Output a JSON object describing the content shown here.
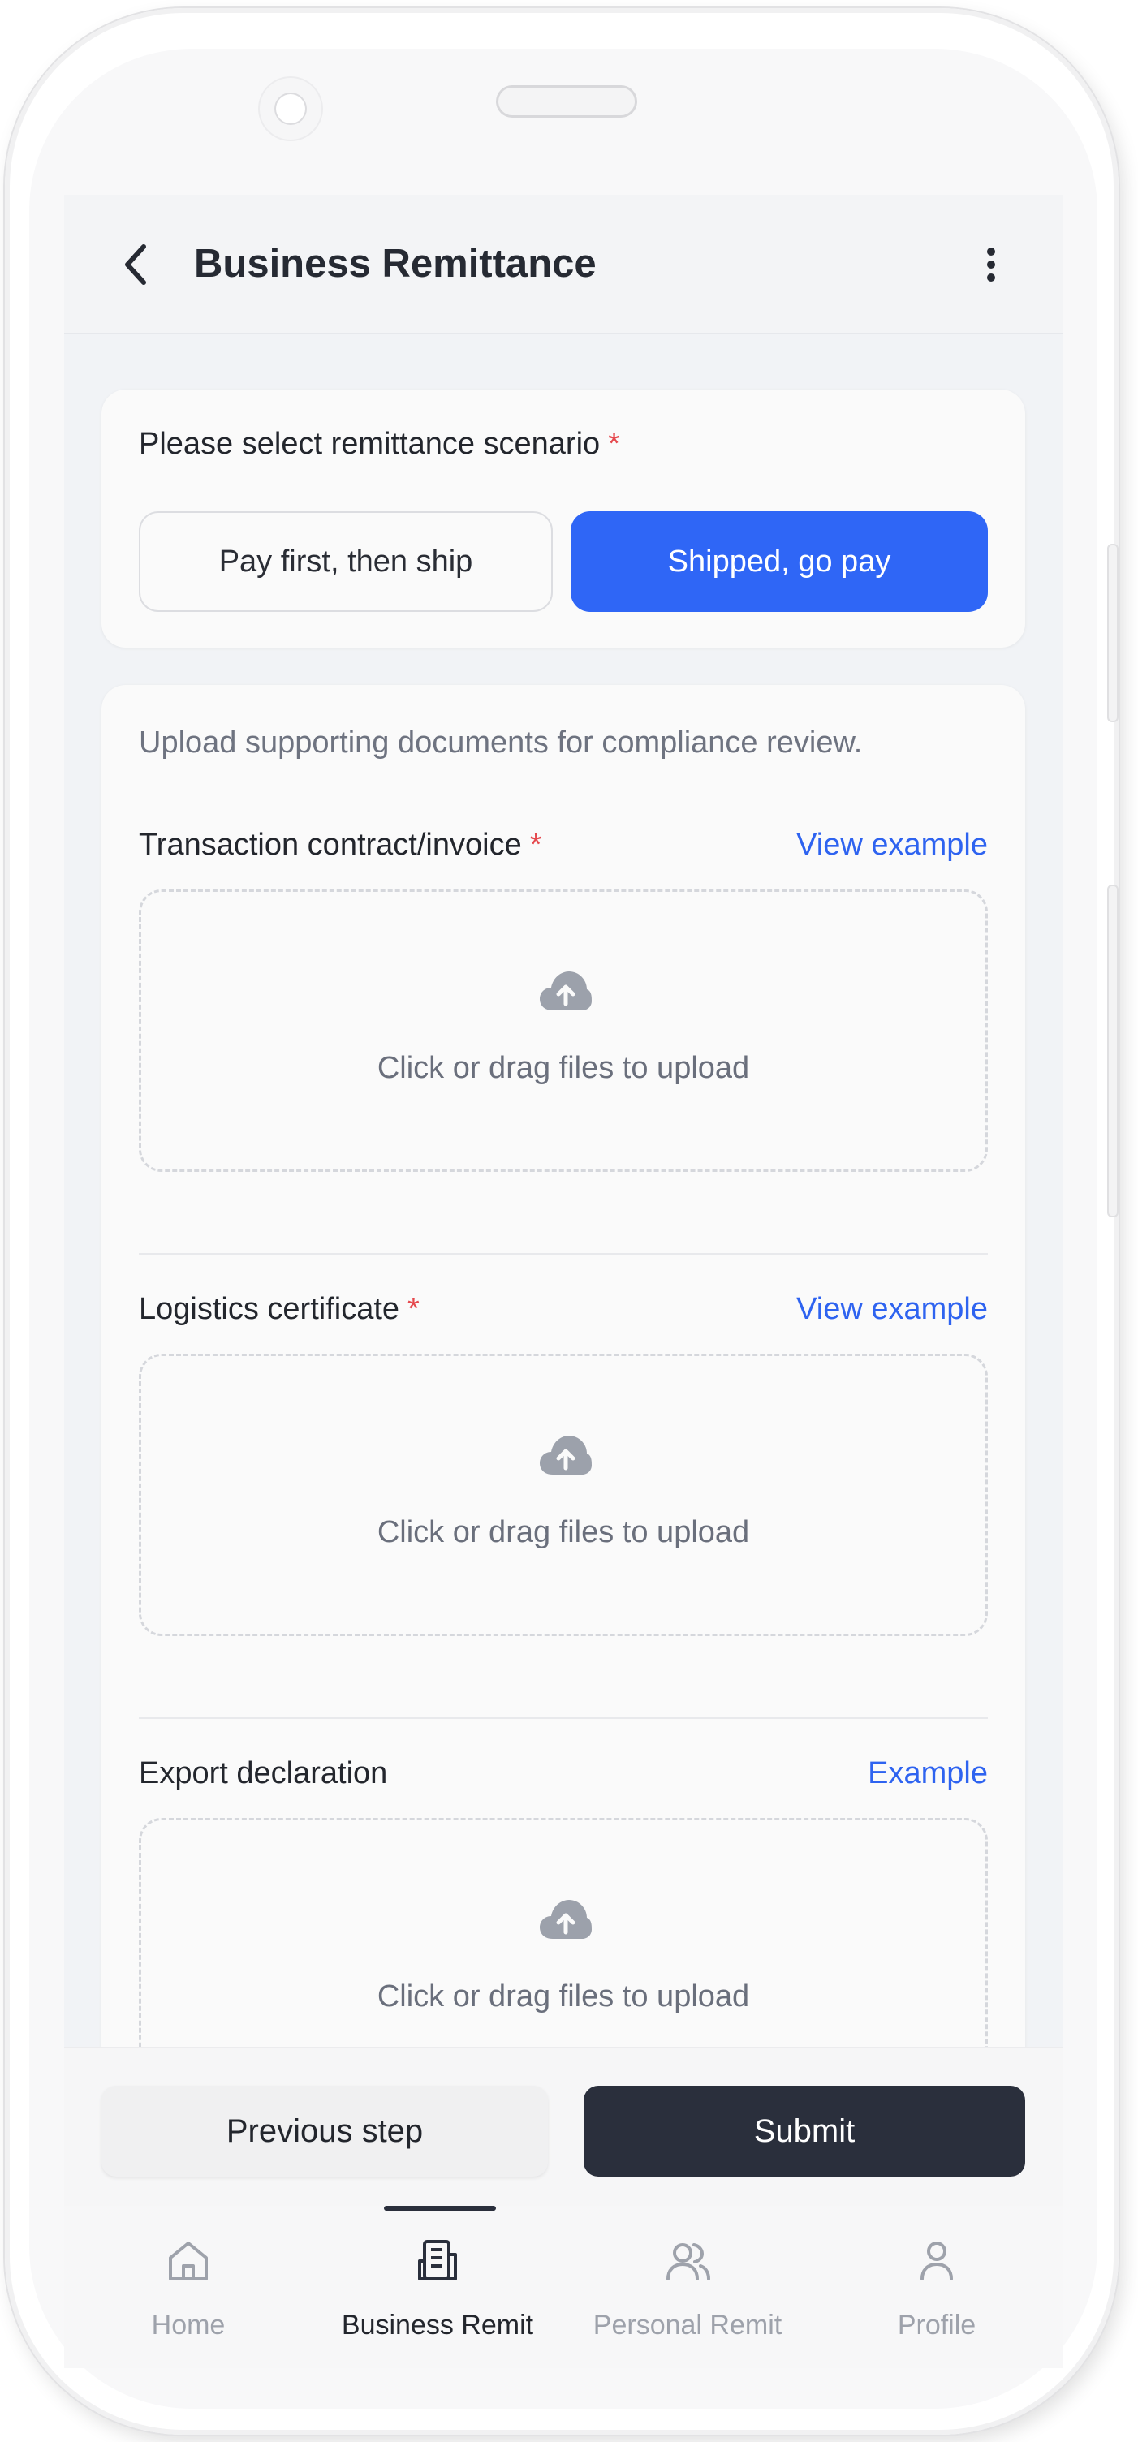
{
  "header": {
    "title": "Business Remittance",
    "back_icon": "chevron-left-icon",
    "more_icon": "more-vertical-icon"
  },
  "scenario": {
    "label": "Please select remittance scenario",
    "required_mark": "*",
    "options": [
      "Pay first, then ship",
      "Shipped, go pay"
    ],
    "selected": "Shipped, go pay"
  },
  "documents": {
    "description": "Upload supporting documents for compliance review.",
    "items": [
      {
        "label": "Transaction contract/invoice",
        "required_mark": "*",
        "link": "View example",
        "upload_text": "Click or drag files to upload"
      },
      {
        "label": "Logistics certificate",
        "required_mark": "*",
        "link": "View example",
        "upload_text": "Click or drag files to upload"
      },
      {
        "label": "Export declaration",
        "required_mark": "",
        "link": "Example",
        "upload_text": "Click or drag files to upload"
      }
    ]
  },
  "actions": {
    "previous": "Previous step",
    "submit": "Submit"
  },
  "tabbar": {
    "items": [
      {
        "label": "Home",
        "icon": "home-icon"
      },
      {
        "label": "Business Remit",
        "icon": "building-icon"
      },
      {
        "label": "Personal Remit",
        "icon": "users-icon"
      },
      {
        "label": "Profile",
        "icon": "user-icon"
      }
    ],
    "active": "Business Remit"
  },
  "colors": {
    "accent": "#2f66f6",
    "primary_dark": "#2a2f3c",
    "required": "#e5484d",
    "link": "#2e63f0"
  }
}
